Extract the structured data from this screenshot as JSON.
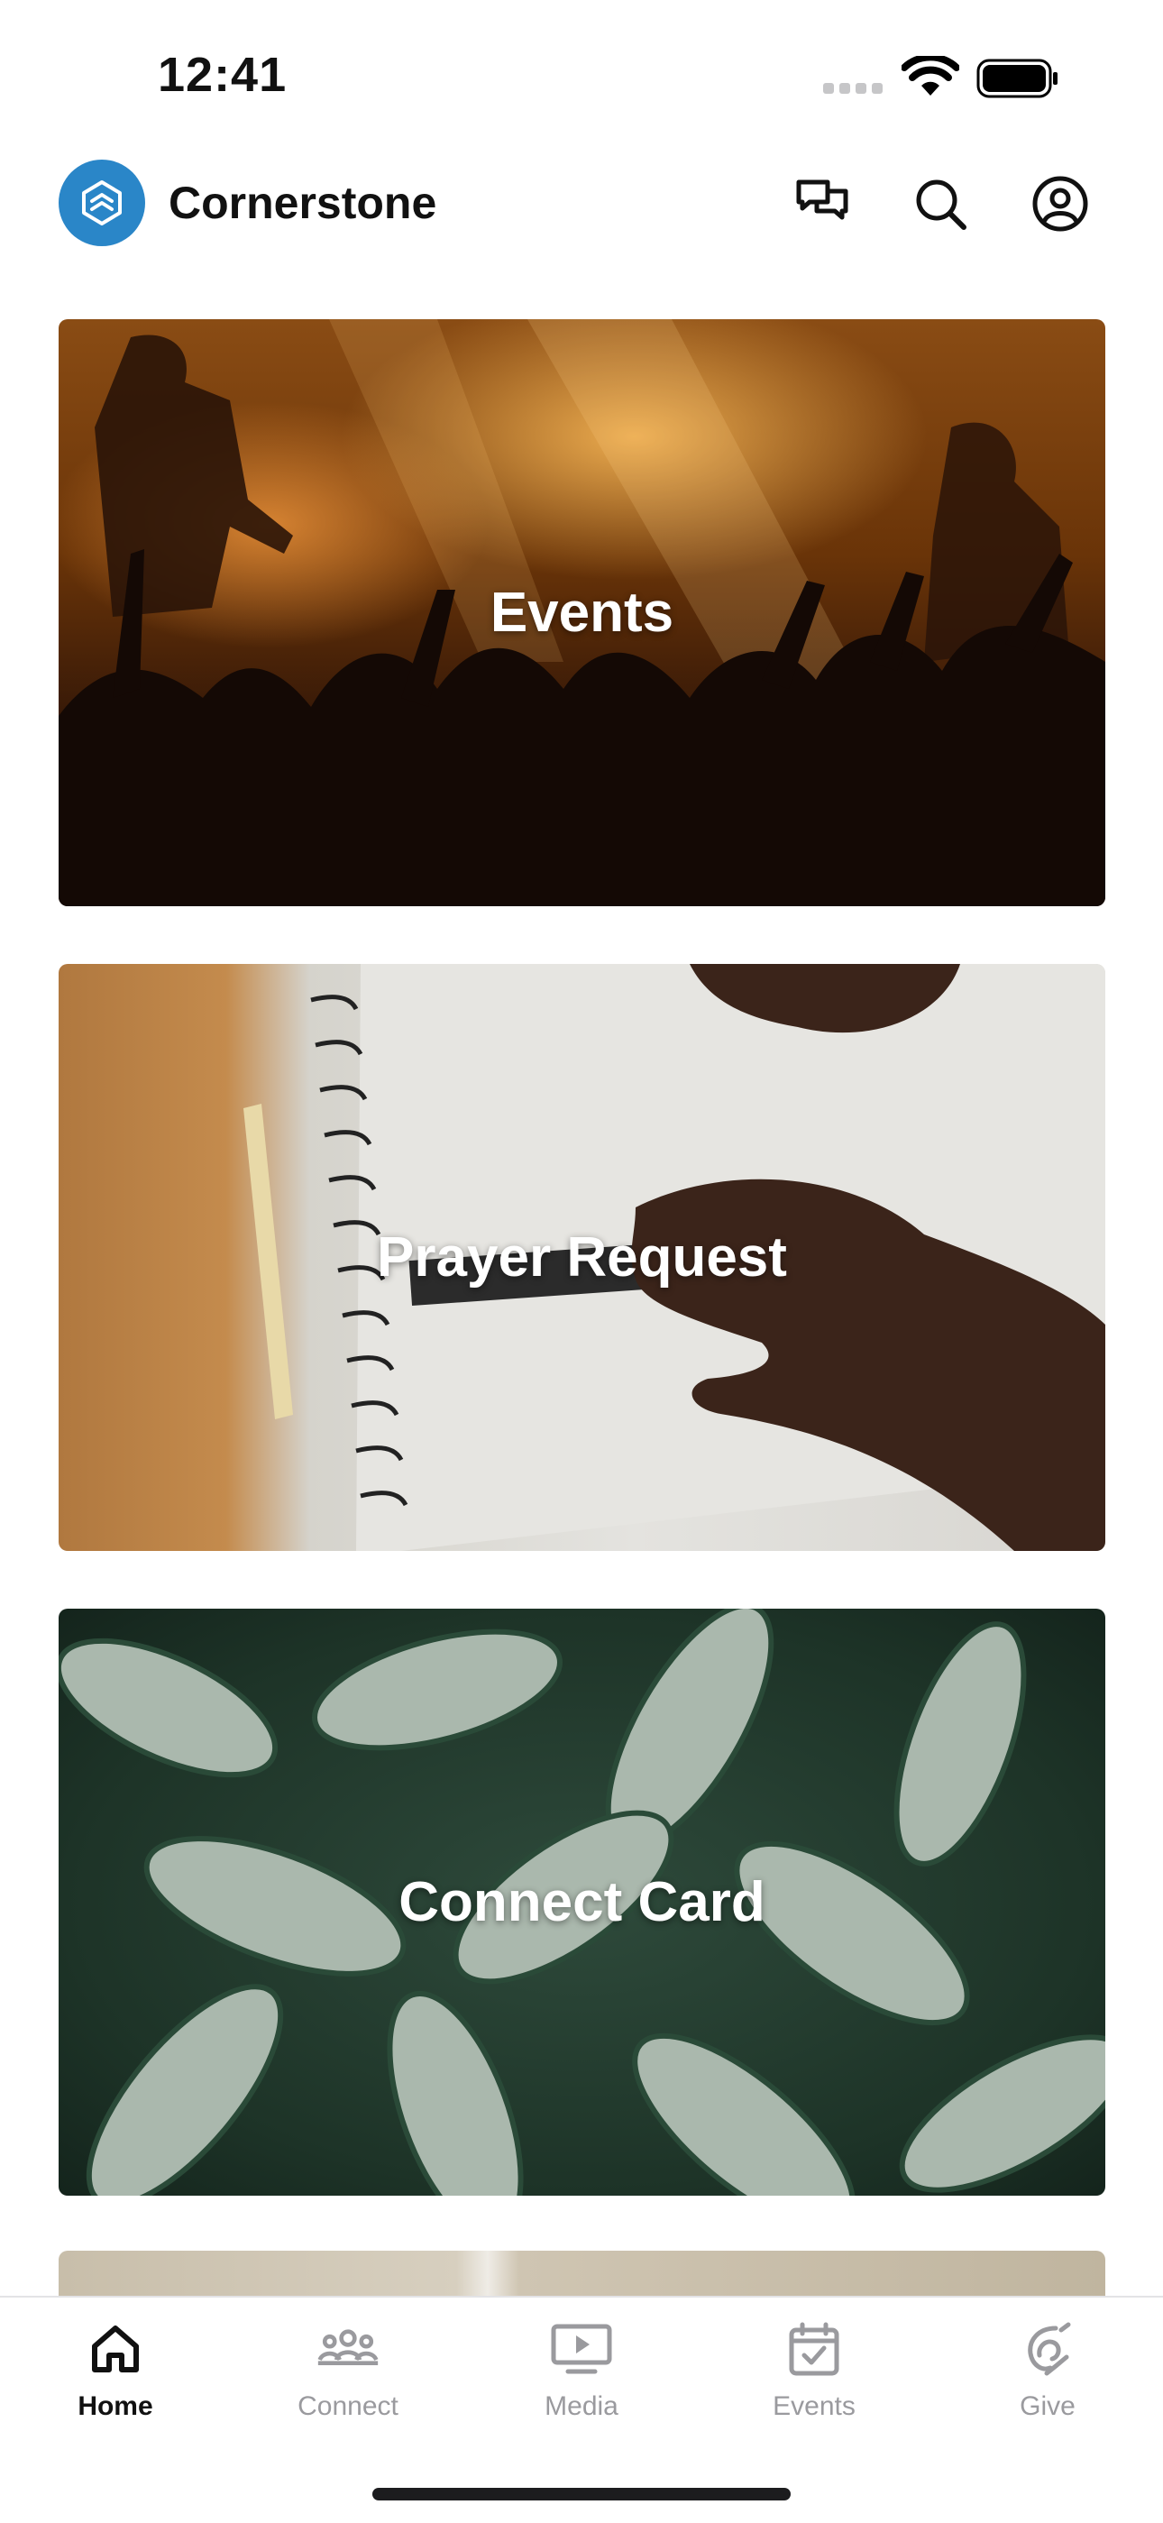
{
  "status_bar": {
    "time": "12:41"
  },
  "header": {
    "app_name": "Cornerstone",
    "brand_color": "#2a86c8",
    "icons": [
      "chat-icon",
      "search-icon",
      "profile-icon"
    ]
  },
  "cards": [
    {
      "label": "Events"
    },
    {
      "label": "Prayer Request"
    },
    {
      "label": "Connect Card"
    }
  ],
  "tabbar": {
    "active": "Home",
    "tabs": [
      {
        "label": "Home",
        "icon": "home-icon"
      },
      {
        "label": "Connect",
        "icon": "people-icon"
      },
      {
        "label": "Media",
        "icon": "media-icon"
      },
      {
        "label": "Events",
        "icon": "calendar-icon"
      },
      {
        "label": "Give",
        "icon": "give-icon"
      }
    ]
  }
}
